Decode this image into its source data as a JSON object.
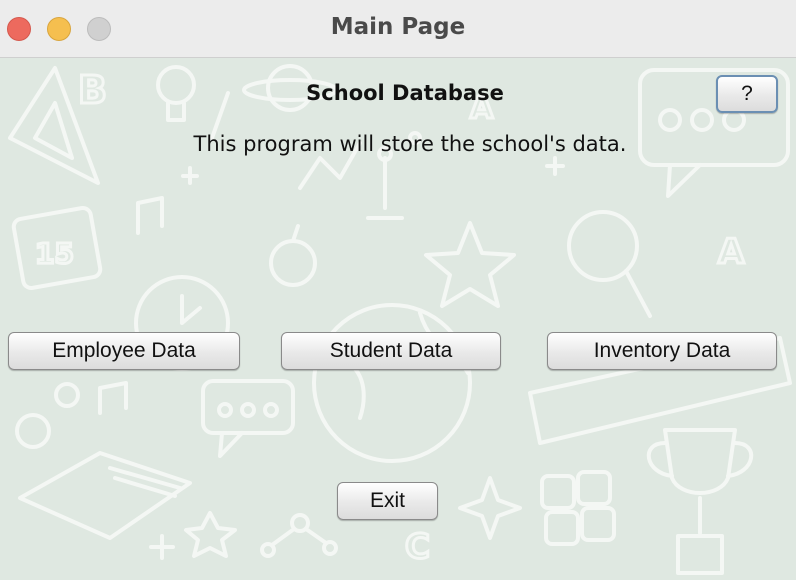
{
  "window": {
    "title": "Main Page",
    "controls": [
      "close",
      "minimize",
      "zoom"
    ]
  },
  "main": {
    "heading": "School Database",
    "description": "This program will store the school's data.",
    "help_label": "?",
    "buttons": {
      "employee": "Employee Data",
      "student": "Student Data",
      "inventory": "Inventory Data"
    },
    "exit_label": "Exit"
  },
  "colors": {
    "background": "#dfe8e1",
    "close": "#ed6a5e",
    "minimize": "#f5bf4f",
    "zoom": "#d0d0d0"
  }
}
